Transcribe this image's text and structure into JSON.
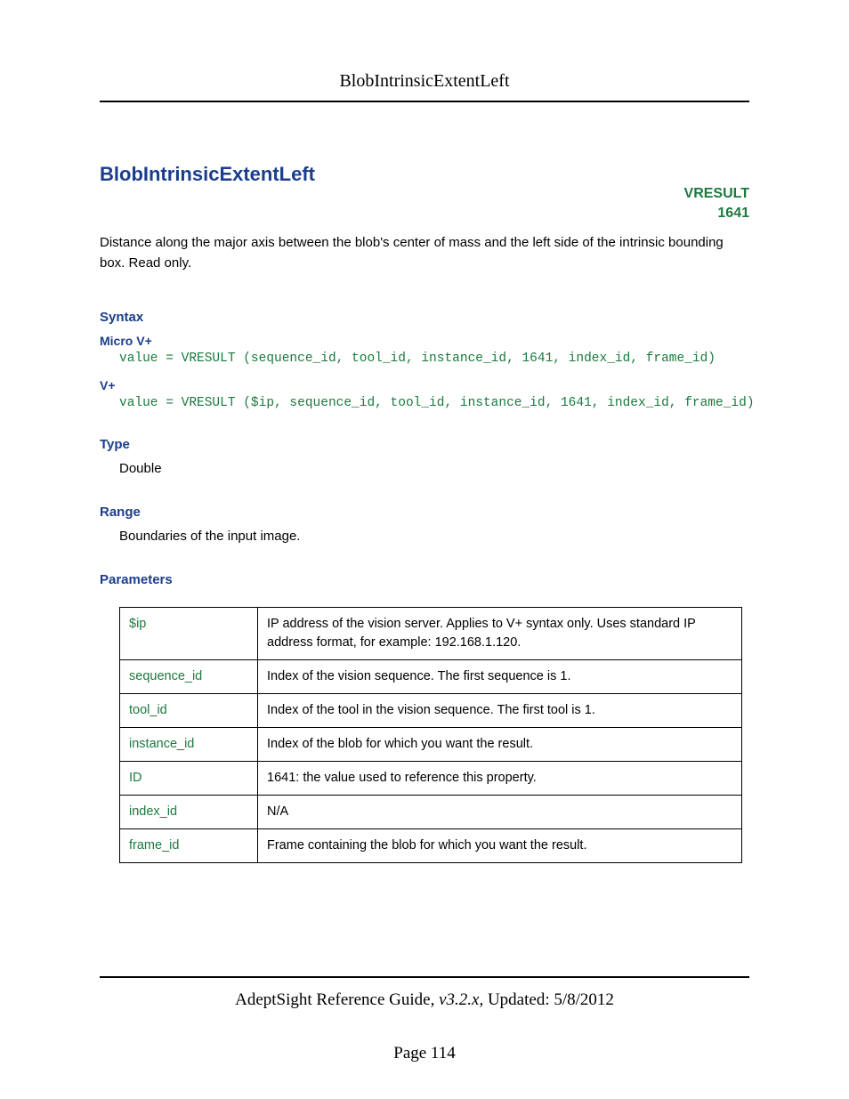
{
  "header": {
    "title": "BlobIntrinsicExtentLeft"
  },
  "title": "BlobIntrinsicExtentLeft",
  "badge": {
    "name": "VRESULT",
    "code": "1641"
  },
  "description": "Distance along the major axis between the blob's center of mass and the left side of the intrinsic bounding box. Read only.",
  "syntax": {
    "heading": "Syntax",
    "micro_label": "Micro V+",
    "micro_code": "value = VRESULT (sequence_id, tool_id, instance_id, 1641, index_id, frame_id)",
    "vplus_label": "V+",
    "vplus_code": "value = VRESULT ($ip, sequence_id, tool_id, instance_id, 1641, index_id, frame_id)"
  },
  "type": {
    "heading": "Type",
    "value": "Double"
  },
  "range": {
    "heading": "Range",
    "value": "Boundaries of the input image."
  },
  "parameters": {
    "heading": "Parameters",
    "rows": [
      {
        "name": "$ip",
        "desc": "IP address of the vision server. Applies to V+ syntax only. Uses standard IP address format, for example: 192.168.1.120."
      },
      {
        "name": "sequence_id",
        "desc": "Index of the vision sequence. The first sequence is 1."
      },
      {
        "name": "tool_id",
        "desc": "Index of the tool in the vision sequence. The first tool is 1."
      },
      {
        "name": "instance_id",
        "desc": "Index of the blob for which you want the result."
      },
      {
        "name": "ID",
        "desc": "1641: the value used to reference this property."
      },
      {
        "name": "index_id",
        "desc": "N/A"
      },
      {
        "name": "frame_id",
        "desc": "Frame containing the blob for which you want the result."
      }
    ]
  },
  "footer": {
    "guide": "AdeptSight Reference Guide",
    "version": ", v3.2.x",
    "updated": ", Updated: 5/8/2012",
    "page": "Page 114"
  }
}
